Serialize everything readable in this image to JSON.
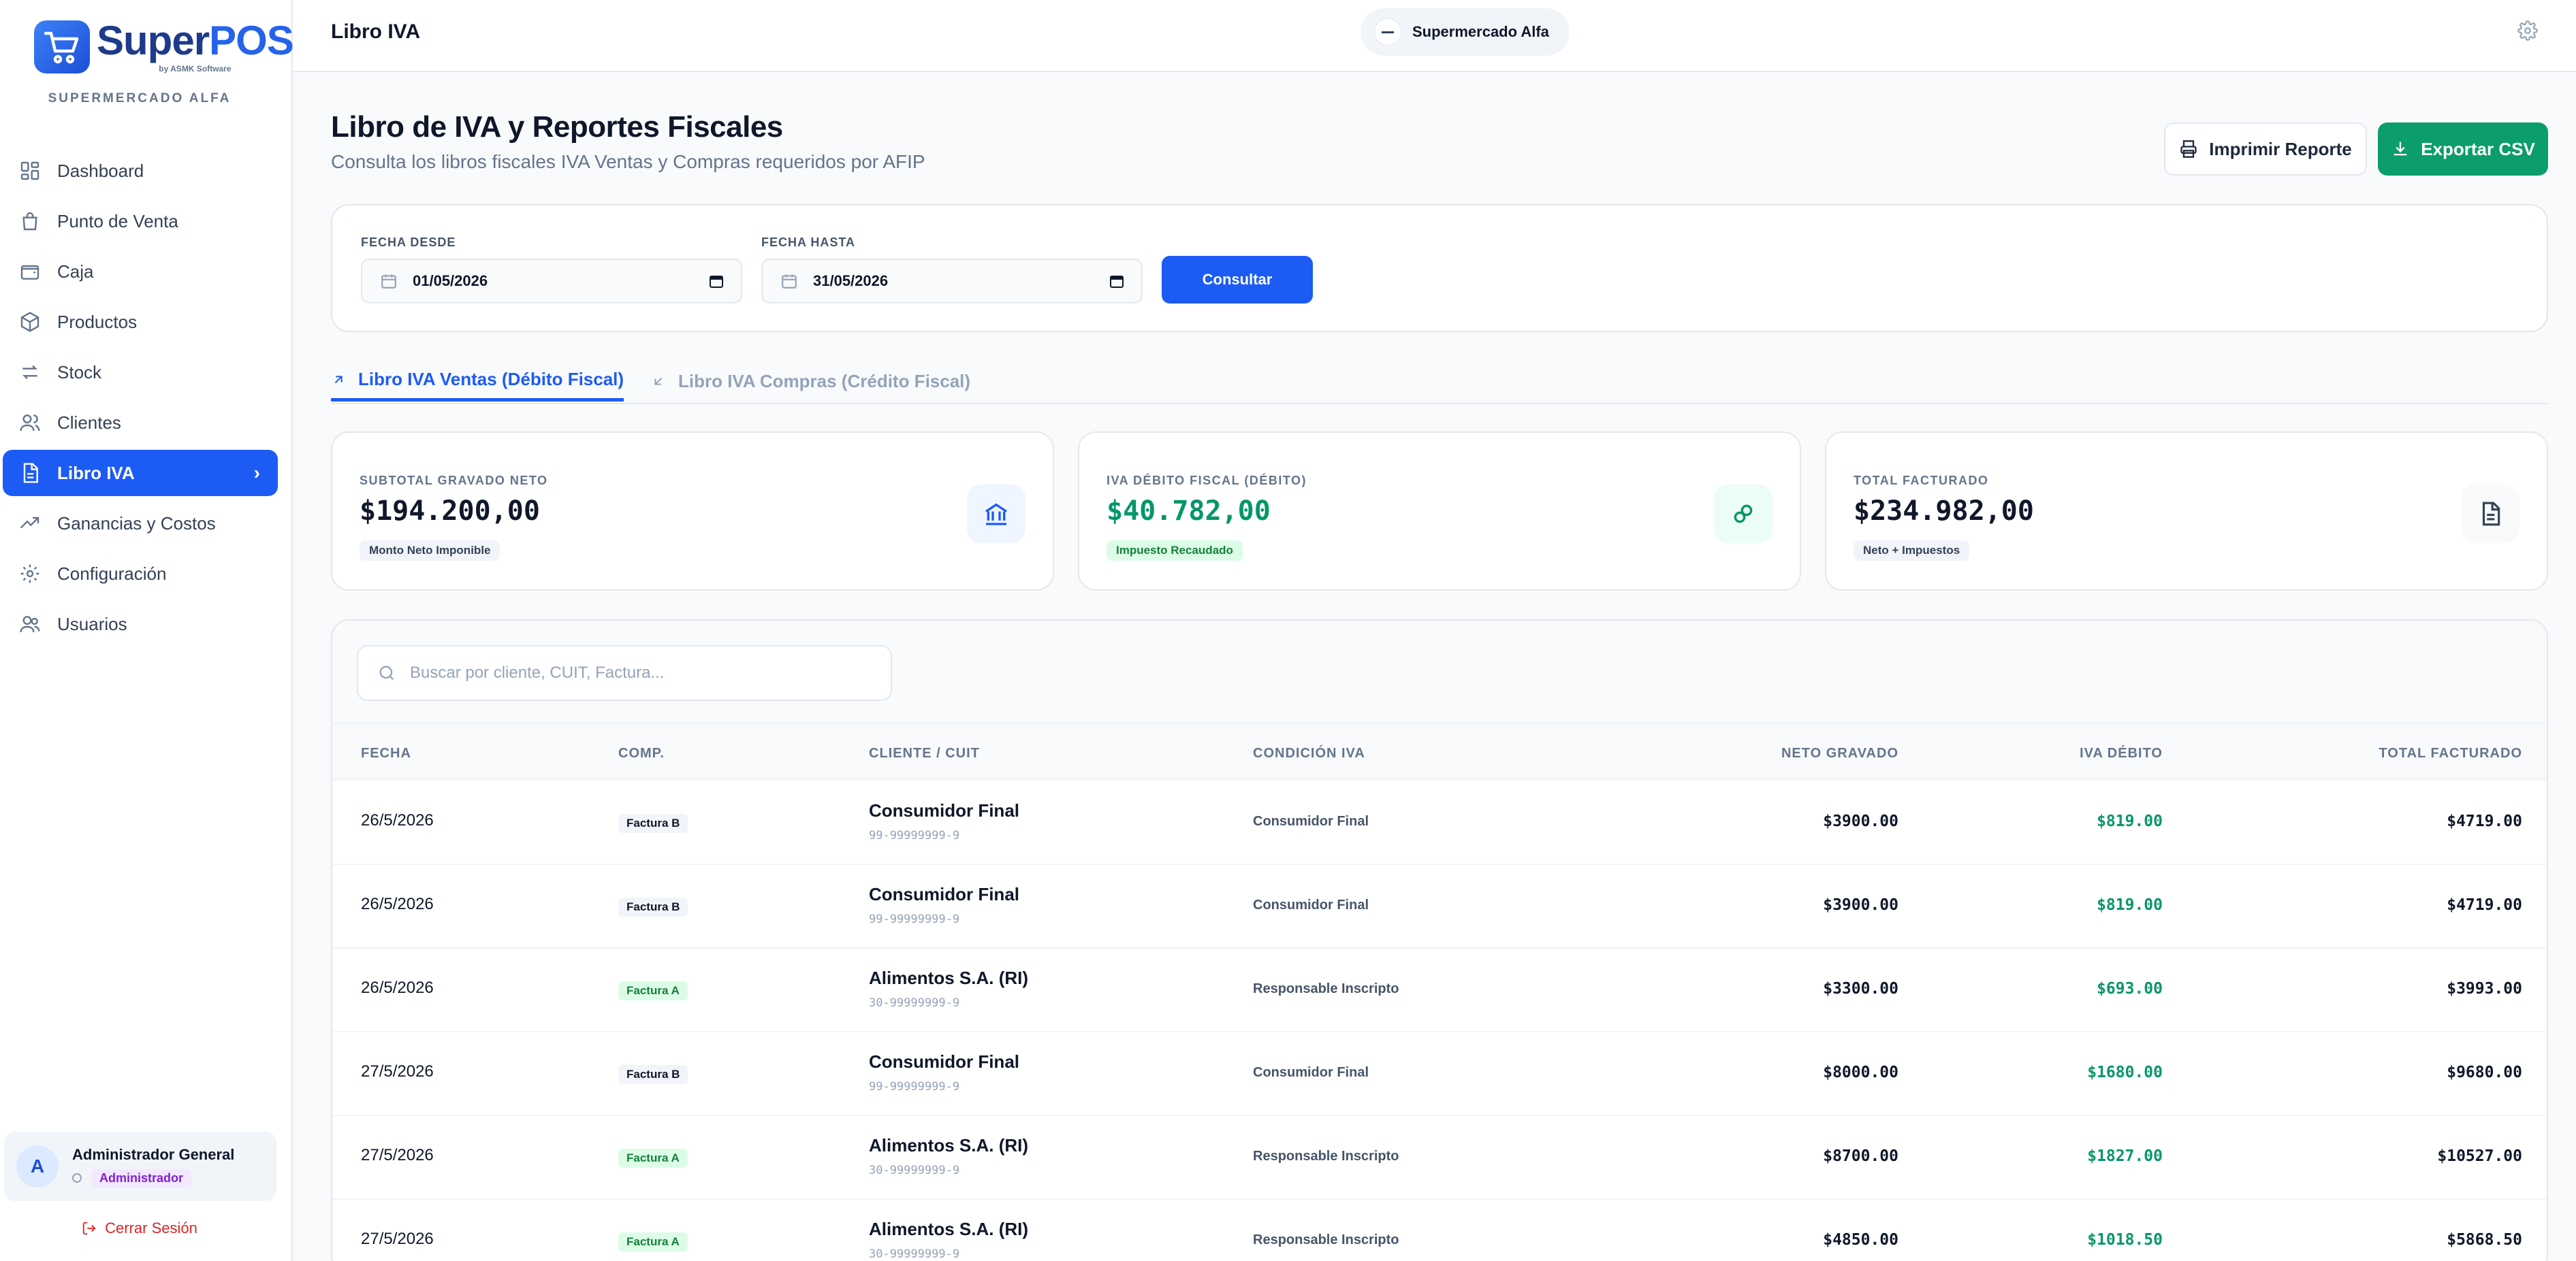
{
  "brand": {
    "name_a": "Super",
    "name_b": "POS",
    "tagline": "by ASMK Software",
    "store": "SUPERMERCADO ALFA"
  },
  "sidebar": {
    "items": [
      {
        "label": "Dashboard",
        "icon": "grid-icon"
      },
      {
        "label": "Punto de Venta",
        "icon": "shopping-bag-icon"
      },
      {
        "label": "Caja",
        "icon": "wallet-icon"
      },
      {
        "label": "Productos",
        "icon": "box-icon"
      },
      {
        "label": "Stock",
        "icon": "arrows-swap-icon"
      },
      {
        "label": "Clientes",
        "icon": "users-icon"
      },
      {
        "label": "Libro IVA",
        "icon": "document-icon",
        "active": true
      },
      {
        "label": "Ganancias y Costos",
        "icon": "trending-up-icon"
      },
      {
        "label": "Configuración",
        "icon": "gear-icon"
      },
      {
        "label": "Usuarios",
        "icon": "user-group-icon"
      }
    ]
  },
  "user": {
    "initial": "A",
    "name": "Administrador General",
    "role": "Administrador"
  },
  "logout_label": "Cerrar Sesión",
  "topbar": {
    "title": "Libro IVA",
    "store": "Supermercado Alfa"
  },
  "page": {
    "title": "Libro de IVA y Reportes Fiscales",
    "subtitle": "Consulta los libros fiscales IVA Ventas y Compras requeridos por AFIP",
    "print_label": "Imprimir Reporte",
    "export_label": "Exportar CSV"
  },
  "filters": {
    "from_label": "FECHA DESDE",
    "from_value": "01/05/2026",
    "to_label": "FECHA HASTA",
    "to_value": "31/05/2026",
    "submit_label": "Consultar"
  },
  "tabs": [
    {
      "label": "Libro IVA Ventas (Débito Fiscal)",
      "active": true
    },
    {
      "label": "Libro IVA Compras (Crédito Fiscal)",
      "active": false
    }
  ],
  "stats": [
    {
      "label": "SUBTOTAL GRAVADO NETO",
      "value": "$194.200,00",
      "badge": "Monto Neto Imponible",
      "icon": "bank-icon"
    },
    {
      "label": "IVA DÉBITO FISCAL (DÉBITO)",
      "value": "$40.782,00",
      "badge": "Impuesto Recaudado",
      "icon": "link-icon"
    },
    {
      "label": "TOTAL FACTURADO",
      "value": "$234.982,00",
      "badge": "Neto + Impuestos",
      "icon": "invoice-icon"
    }
  ],
  "colors": {
    "primary": "#1d5bf5",
    "success": "#0b9d6b",
    "danger": "#dc2626",
    "purple": "#7e22ce"
  },
  "search": {
    "placeholder": "Buscar por cliente, CUIT, Factura..."
  },
  "table": {
    "headers": [
      "FECHA",
      "COMP.",
      "CLIENTE / CUIT",
      "CONDICIÓN IVA",
      "NETO GRAVADO",
      "IVA DÉBITO",
      "TOTAL FACTURADO"
    ],
    "rows": [
      {
        "date": "26/5/2026",
        "comp": "Factura B",
        "client": "Consumidor Final",
        "cuit": "99-99999999-9",
        "cond": "Consumidor Final",
        "neto": "$3900.00",
        "iva": "$819.00",
        "total": "$4719.00"
      },
      {
        "date": "26/5/2026",
        "comp": "Factura B",
        "client": "Consumidor Final",
        "cuit": "99-99999999-9",
        "cond": "Consumidor Final",
        "neto": "$3900.00",
        "iva": "$819.00",
        "total": "$4719.00"
      },
      {
        "date": "26/5/2026",
        "comp": "Factura A",
        "client": "Alimentos S.A. (RI)",
        "cuit": "30-99999999-9",
        "cond": "Responsable Inscripto",
        "neto": "$3300.00",
        "iva": "$693.00",
        "total": "$3993.00"
      },
      {
        "date": "27/5/2026",
        "comp": "Factura B",
        "client": "Consumidor Final",
        "cuit": "99-99999999-9",
        "cond": "Consumidor Final",
        "neto": "$8000.00",
        "iva": "$1680.00",
        "total": "$9680.00"
      },
      {
        "date": "27/5/2026",
        "comp": "Factura A",
        "client": "Alimentos S.A. (RI)",
        "cuit": "30-99999999-9",
        "cond": "Responsable Inscripto",
        "neto": "$8700.00",
        "iva": "$1827.00",
        "total": "$10527.00"
      },
      {
        "date": "27/5/2026",
        "comp": "Factura A",
        "client": "Alimentos S.A. (RI)",
        "cuit": "30-99999999-9",
        "cond": "Responsable Inscripto",
        "neto": "$4850.00",
        "iva": "$1018.50",
        "total": "$5868.50"
      }
    ]
  }
}
